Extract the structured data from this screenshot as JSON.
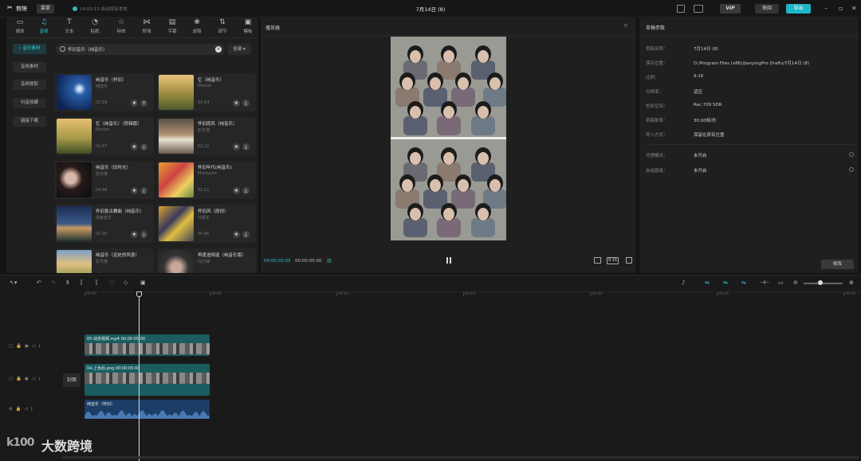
{
  "titlebar": {
    "app_name": "剪映",
    "menu_label": "菜单",
    "autosave": "14:00:13 自动保存本地",
    "project_title": "7月14日 (8)",
    "vip_label": "VIP",
    "review_label": "审阅",
    "export_label": "导出"
  },
  "media_tabs": [
    {
      "label": "媒体",
      "icon": "media-icon"
    },
    {
      "label": "音频",
      "icon": "audio-icon"
    },
    {
      "label": "文本",
      "icon": "text-icon"
    },
    {
      "label": "贴纸",
      "icon": "sticker-icon"
    },
    {
      "label": "特效",
      "icon": "effects-icon"
    },
    {
      "label": "转场",
      "icon": "transition-icon"
    },
    {
      "label": "字幕",
      "icon": "subtitle-icon"
    },
    {
      "label": "滤镜",
      "icon": "filter-icon"
    },
    {
      "label": "调节",
      "icon": "adjust-icon"
    },
    {
      "label": "模板",
      "icon": "template-icon"
    }
  ],
  "audio_sidebar": [
    "• 音乐素材",
    "音效素材",
    "音频提取",
    "抖音收藏",
    "链接下载"
  ],
  "search": {
    "value": "怀旧音乐（纯音乐）",
    "filter_label": "全部"
  },
  "music_cards": [
    {
      "title": "纯音乐（怀旧）",
      "artist": "纯音乐",
      "duration": "02:59"
    },
    {
      "title": "忆（纯音乐）",
      "artist": "Electer",
      "duration": "02:14"
    },
    {
      "title": "忆（纯音乐）（剪辑版）",
      "artist": "Electer",
      "duration": "01:47"
    },
    {
      "title": "怀旧庭风（纯音乐）",
      "artist": "彭华港",
      "duration": "02:22"
    },
    {
      "title": "纯音乐（旧时光）",
      "artist": "彭华港",
      "duration": "04:46"
    },
    {
      "title": "怀旧年代(纯音乐)",
      "artist": "Mimiuutic",
      "duration": "01:11"
    },
    {
      "title": "怀旧复古舞曲（纯音乐）",
      "artist": "漫傣音乐",
      "duration": "01:00"
    },
    {
      "title": "怀旧风（原创）",
      "artist": "付振东",
      "duration": "00:46"
    },
    {
      "title": "纯音乐（远处的风景）",
      "artist": "彭华港",
      "duration": ""
    },
    {
      "title": "再度追相逢（纯音乐版）",
      "artist": "DJ力峰",
      "duration": ""
    }
  ],
  "player": {
    "title": "播放器",
    "time_current": "00:00:02:05",
    "time_total": "00:00:05:00",
    "ratio_label": "9:16"
  },
  "draft": {
    "title": "草稿参数",
    "props": [
      {
        "label": "草稿名称：",
        "value": "7月14日 (8)"
      },
      {
        "label": "保存位置：",
        "value": "D:/Program Files (x86)/JianyingPro Drafts/7月14日 (8)"
      },
      {
        "label": "比例：",
        "value": "9:16"
      },
      {
        "label": "分辨率：",
        "value": "适应"
      },
      {
        "label": "色彩空间：",
        "value": "Rec.709 SDR"
      },
      {
        "label": "草稿帧率：",
        "value": "30.00帧/秒"
      },
      {
        "label": "导入方式：",
        "value": "保留在原有位置"
      }
    ],
    "props2": [
      {
        "label": "代理模式：",
        "value": "未开启"
      },
      {
        "label": "自由层级：",
        "value": "未开启"
      }
    ],
    "modify_label": "修改"
  },
  "timeline": {
    "ticks": [
      "00:00",
      "00:05",
      "00:10",
      "00:15",
      "00:20",
      "00:25",
      "00:30"
    ],
    "cover_label": "封面",
    "clips": [
      {
        "name": "05-动态视频.mp4   00:00:05:00"
      },
      {
        "name": "04-上色后.png   00:00:05:00"
      },
      {
        "name": "纯音乐（怀旧）"
      }
    ]
  },
  "watermark": {
    "logo": "k100",
    "text": "大数跨境"
  },
  "colors": {
    "accent": "#2bc3d8",
    "export": "#1fb6c9",
    "video_clip": "#1a5c60",
    "audio_clip": "#1c3d66"
  }
}
